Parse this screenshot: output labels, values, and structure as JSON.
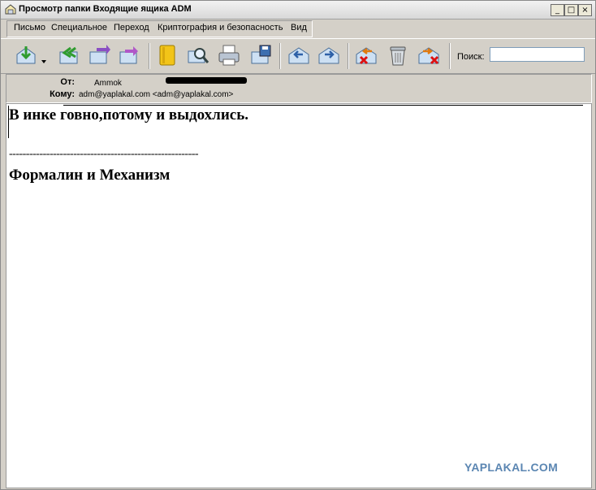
{
  "window": {
    "title": "Просмотр папки Входящие ящика ADM",
    "controls": {
      "minimize": "_",
      "maximize": "□",
      "close": "×"
    }
  },
  "menu": {
    "items": [
      {
        "label": "Письмо"
      },
      {
        "label": "Специальное"
      },
      {
        "label": "Переход"
      },
      {
        "label": "Криптография и безопасность"
      },
      {
        "label": "Вид"
      }
    ]
  },
  "toolbar": {
    "buttons": [
      {
        "icon": "get-mail-icon"
      },
      {
        "icon": "dropdown-arrow-icon"
      },
      {
        "icon": "reply-all-icon"
      },
      {
        "icon": "forward-icon"
      },
      {
        "icon": "forward-inline-icon"
      },
      {
        "icon": "address-book-icon"
      },
      {
        "icon": "find-icon"
      },
      {
        "icon": "print-icon"
      },
      {
        "icon": "save-icon"
      },
      {
        "icon": "previous-message-icon"
      },
      {
        "icon": "next-message-icon"
      },
      {
        "icon": "delete-message-icon"
      },
      {
        "icon": "trash-icon"
      },
      {
        "icon": "junk-icon"
      }
    ],
    "search_label": "Поиск:",
    "search_value": ""
  },
  "headers": {
    "from_label": "От:",
    "from_value": "Ammok",
    "to_label": "Кому:",
    "to_value": "adm@yaplakal.com <adm@yaplakal.com>"
  },
  "message": {
    "line1": "В инке говно,потому и выдохлись.",
    "rule": "--------------------------------------------------------",
    "line2": "Формалин и Механизм"
  },
  "watermark": "YAPLAKAL.COM",
  "colors": {
    "watermark": "#5b86b2",
    "chrome": "#d4d0c8"
  }
}
